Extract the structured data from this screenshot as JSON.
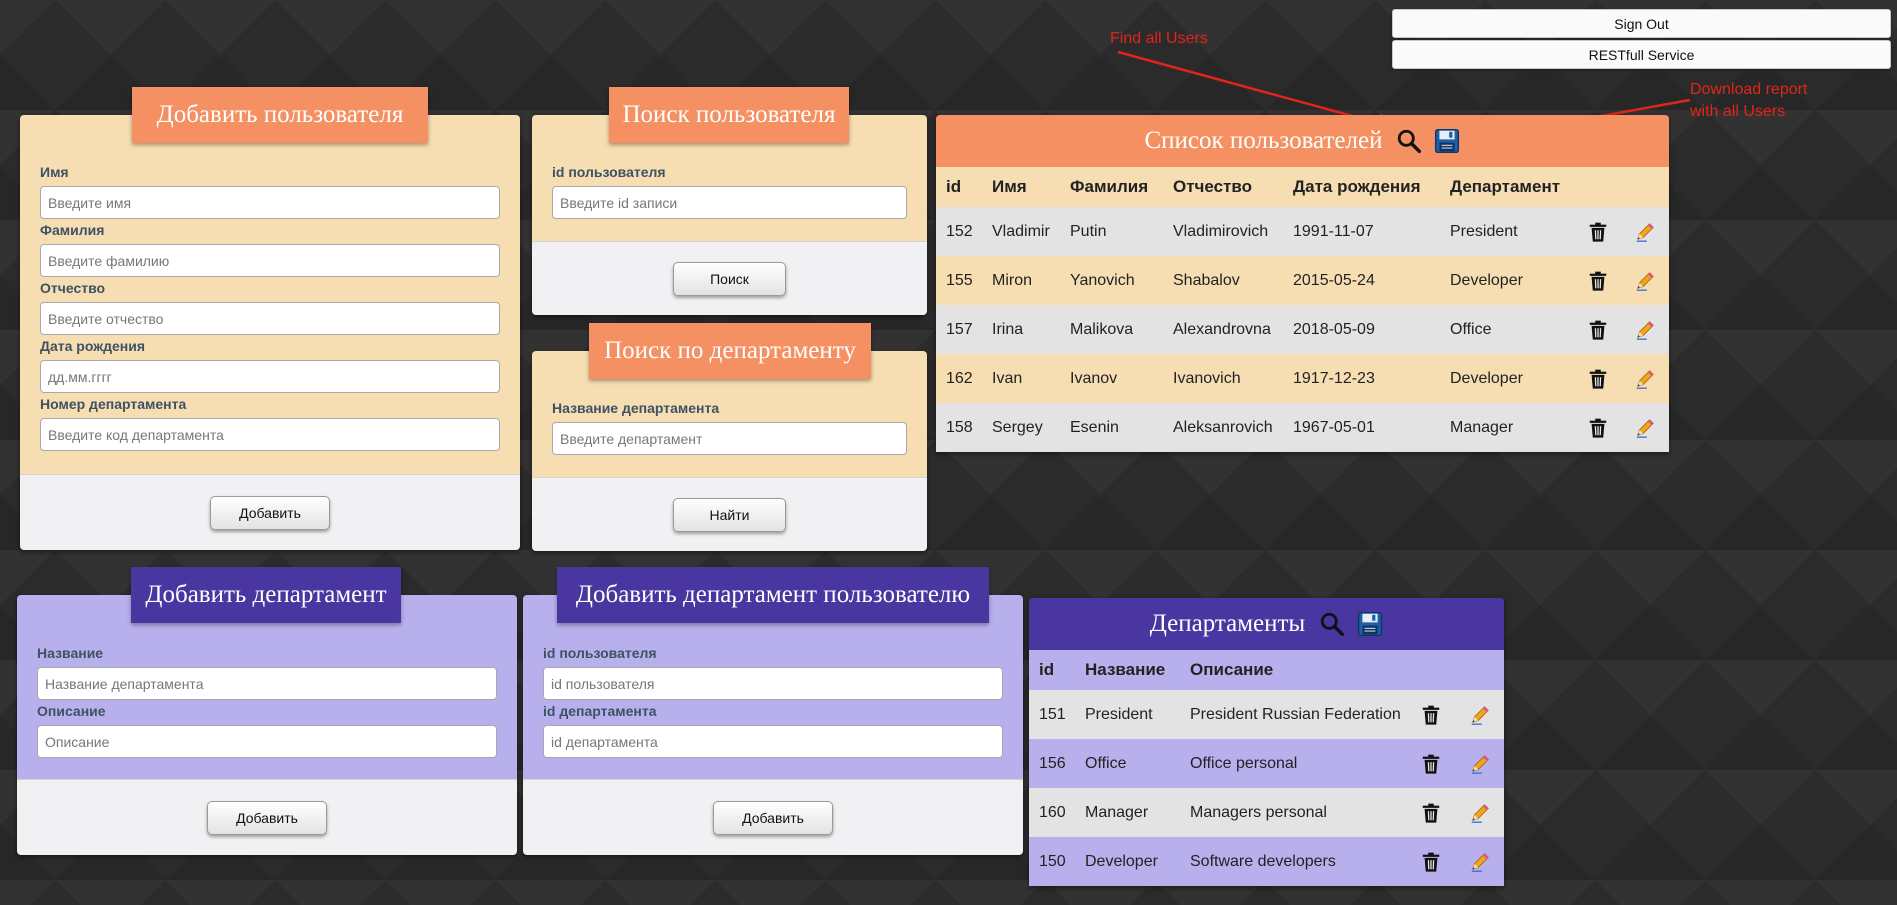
{
  "top_buttons": {
    "sign_out": "Sign Out",
    "restful": "RESTfull Service"
  },
  "annotations": {
    "find_all": "Find all Users",
    "download_line1": "Download report",
    "download_line2": "with all Users"
  },
  "add_user": {
    "title": "Добавить пользователя",
    "fields": [
      {
        "label": "Имя",
        "placeholder": "Введите имя"
      },
      {
        "label": "Фамилия",
        "placeholder": "Введите фамилию"
      },
      {
        "label": "Отчество",
        "placeholder": "Введите отчество"
      },
      {
        "label": "Дата рождения",
        "placeholder": "дд.мм.гггг"
      },
      {
        "label": "Номер департамента",
        "placeholder": "Введите код департамента"
      }
    ],
    "button": "Добавить"
  },
  "search_user": {
    "title": "Поиск пользователя",
    "label": "id пользователя",
    "placeholder": "Введите id записи",
    "button": "Поиск"
  },
  "search_dept": {
    "title": "Поиск по департаменту",
    "label": "Название департамента",
    "placeholder": "Введите департамент",
    "button": "Найти"
  },
  "users_table": {
    "title": "Список пользователей",
    "columns": [
      "id",
      "Имя",
      "Фамилия",
      "Отчество",
      "Дата рождения",
      "Департамент"
    ],
    "rows": [
      [
        "152",
        "Vladimir",
        "Putin",
        "Vladimirovich",
        "1991-11-07",
        "President"
      ],
      [
        "155",
        "Miron",
        "Yanovich",
        "Shabalov",
        "2015-05-24",
        "Developer"
      ],
      [
        "157",
        "Irina",
        "Malikova",
        "Alexandrovna",
        "2018-05-09",
        "Office"
      ],
      [
        "162",
        "Ivan",
        "Ivanov",
        "Ivanovich",
        "1917-12-23",
        "Developer"
      ],
      [
        "158",
        "Sergey",
        "Esenin",
        "Aleksanrovich",
        "1967-05-01",
        "Manager"
      ]
    ]
  },
  "add_dept": {
    "title": "Добавить департамент",
    "fields": [
      {
        "label": "Название",
        "placeholder": "Название департамента"
      },
      {
        "label": "Описание",
        "placeholder": "Описание"
      }
    ],
    "button": "Добавить"
  },
  "add_dept_user": {
    "title": "Добавить департамент пользователю",
    "fields": [
      {
        "label": "id пользователя",
        "placeholder": "id пользователя"
      },
      {
        "label": "id департамента",
        "placeholder": "id департамента"
      }
    ],
    "button": "Добавить"
  },
  "dept_table": {
    "title": "Департаменты",
    "columns": [
      "id",
      "Название",
      "Описание"
    ],
    "rows": [
      [
        "151",
        "President",
        "President Russian Federation"
      ],
      [
        "156",
        "Office",
        "Office personal"
      ],
      [
        "160",
        "Manager",
        "Managers personal"
      ],
      [
        "150",
        "Developer",
        "Software developers"
      ]
    ]
  },
  "icons": {
    "search": "search-icon",
    "save": "floppy-disk-icon",
    "delete": "trash-icon",
    "edit": "pencil-icon"
  },
  "colors": {
    "orange_header": "#f59063",
    "orange_body": "#f6deb2",
    "purple_header": "#4a36a0",
    "purple_body": "#b8b0ec",
    "annotation": "#e0251b"
  }
}
